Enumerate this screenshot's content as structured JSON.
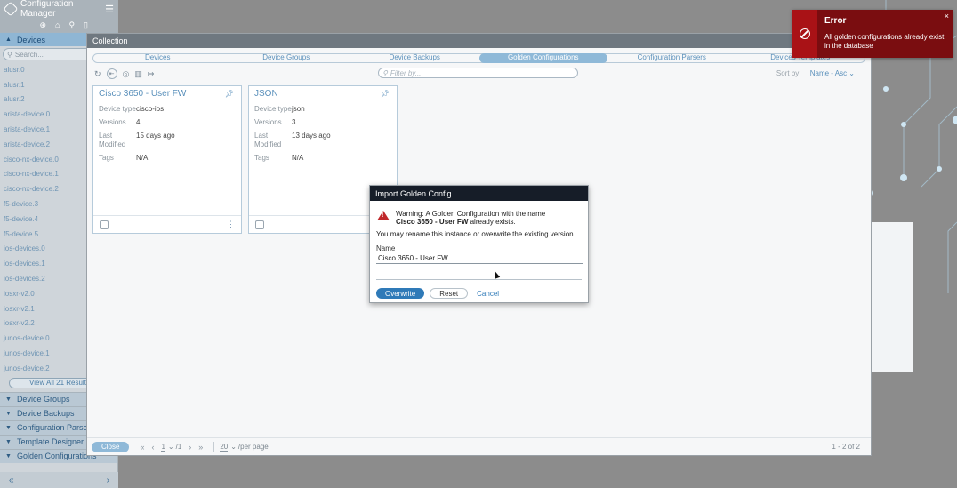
{
  "app": {
    "title": "Configuration Manager"
  },
  "sidebar": {
    "devices_section": "Devices",
    "search_placeholder": "Search...",
    "devices": [
      "alusr.0",
      "alusr.1",
      "alusr.2",
      "arista-device.0",
      "arista-device.1",
      "arista-device.2",
      "cisco-nx-device.0",
      "cisco-nx-device.1",
      "cisco-nx-device.2",
      "f5-device.3",
      "f5-device.4",
      "f5-device.5",
      "ios-devices.0",
      "ios-devices.1",
      "ios-devices.2",
      "iosxr-v2.0",
      "iosxr-v2.1",
      "iosxr-v2.2",
      "junos-device.0",
      "junos-device.1",
      "junos-device.2"
    ],
    "view_all": "View All 21 Results",
    "sections": [
      "Device Groups",
      "Device Backups",
      "Configuration Parsers",
      "Template Designer",
      "Golden Configurations"
    ],
    "footer_left": "«",
    "footer_right": "›"
  },
  "collection": {
    "title": "Collection",
    "tabs": [
      "Devices",
      "Device Groups",
      "Device Backups",
      "Golden Configurations",
      "Configuration Parsers",
      "Devices Templates"
    ],
    "active_tab": "Golden Configurations",
    "filter_placeholder": "Filter by...",
    "sort_label": "Sort by:",
    "sort_value": "Name - Asc",
    "cards": [
      {
        "title": "Cisco 3650 - User FW",
        "device_type_label": "Device type",
        "device_type": "cisco-ios",
        "versions_label": "Versions",
        "versions": "4",
        "last_modified_label": "Last Modified",
        "last_modified": "15 days ago",
        "tags_label": "Tags",
        "tags": "N/A"
      },
      {
        "title": "JSON",
        "device_type_label": "Device type",
        "device_type": "json",
        "versions_label": "Versions",
        "versions": "3",
        "last_modified_label": "Last Modified",
        "last_modified": "13 days ago",
        "tags_label": "Tags",
        "tags": "N/A"
      }
    ],
    "pager": {
      "close": "Close",
      "page": "1",
      "of": "/1",
      "per_page_value": "20",
      "per_page_label": "/per page",
      "count": "1 - 2 of 2"
    }
  },
  "modal": {
    "title": "Import Golden Config",
    "warning_prefix": "Warning: A Golden Configuration with the name",
    "warning_name": "Cisco 3650 - User FW",
    "warning_suffix": "already exists.",
    "info": "You may rename this instance or overwrite the existing version.",
    "name_label": "Name",
    "name_value": "Cisco 3650 - User FW",
    "overwrite": "Overwrite",
    "reset": "Reset",
    "cancel": "Cancel"
  },
  "toast": {
    "title": "Error",
    "message": "All golden configurations already exist in the database",
    "color": "#7a0d10"
  }
}
